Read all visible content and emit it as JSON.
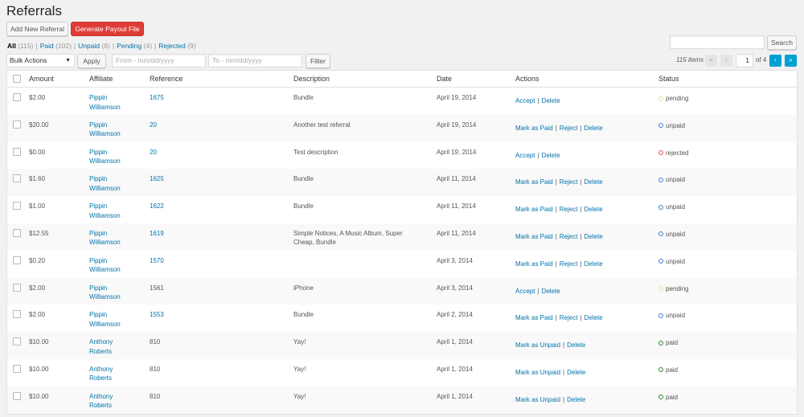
{
  "page_title": "Referrals",
  "header_buttons": {
    "add_new": "Add New Referral",
    "generate_payout": "Generate Payout File"
  },
  "views": [
    {
      "label": "All",
      "count": "(115)",
      "current": true
    },
    {
      "label": "Paid",
      "count": "(102)"
    },
    {
      "label": "Unpaid",
      "count": "(8)"
    },
    {
      "label": "Pending",
      "count": "(4)"
    },
    {
      "label": "Rejected",
      "count": "(9)"
    }
  ],
  "search": {
    "placeholder": "",
    "button": "Search"
  },
  "bulk": {
    "selected": "Bulk Actions",
    "apply": "Apply"
  },
  "date_filter": {
    "from_placeholder": "From - mm/dd/yyyy",
    "to_placeholder": "To - mm/dd/yyyy",
    "filter": "Filter"
  },
  "pagination": {
    "items": "115 items",
    "first": "«",
    "prev": "‹",
    "current_page": "1",
    "of_label": "of 4",
    "next": "›",
    "last": "»"
  },
  "columns": {
    "amount": "Amount",
    "affiliate": "Affiliate",
    "reference": "Reference",
    "description": "Description",
    "date": "Date",
    "actions": "Actions",
    "status": "Status"
  },
  "status_colors": {
    "pending": "#e6e6a0",
    "unpaid": "#3b7ed0",
    "rejected": "#e2584b",
    "paid": "#2a8a2a"
  },
  "rows": [
    {
      "amount": "$2.00",
      "affiliate": [
        "Pippin",
        "Williamson"
      ],
      "reference": "1675",
      "reference_link": true,
      "description": [
        "Bundle"
      ],
      "date": "April 19, 2014",
      "actions": [
        "Accept",
        "Delete"
      ],
      "status": "pending"
    },
    {
      "amount": "$20.00",
      "affiliate": [
        "Pippin",
        "Williamson"
      ],
      "reference": "20",
      "reference_link": true,
      "description": [
        "Another test referral"
      ],
      "date": "April 19, 2014",
      "actions": [
        "Mark as Paid",
        "Reject",
        "Delete"
      ],
      "status": "unpaid"
    },
    {
      "amount": "$0.00",
      "affiliate": [
        "Pippin",
        "Williamson"
      ],
      "reference": "20",
      "reference_link": true,
      "description": [
        "Test description"
      ],
      "date": "April 19, 2014",
      "actions": [
        "Accept",
        "Delete"
      ],
      "status": "rejected"
    },
    {
      "amount": "$1.60",
      "affiliate": [
        "Pippin",
        "Williamson"
      ],
      "reference": "1625",
      "reference_link": true,
      "description": [
        "Bundle"
      ],
      "date": "April 11, 2014",
      "actions": [
        "Mark as Paid",
        "Reject",
        "Delete"
      ],
      "status": "unpaid"
    },
    {
      "amount": "$1.00",
      "affiliate": [
        "Pippin",
        "Williamson"
      ],
      "reference": "1622",
      "reference_link": true,
      "description": [
        "Bundle"
      ],
      "date": "April 11, 2014",
      "actions": [
        "Mark as Paid",
        "Reject",
        "Delete"
      ],
      "status": "unpaid"
    },
    {
      "amount": "$12.55",
      "affiliate": [
        "Pippin",
        "Williamson"
      ],
      "reference": "1619",
      "reference_link": true,
      "description": [
        "Simple Notices, A Music Album, Super",
        "Cheap, Bundle"
      ],
      "date": "April 11, 2014",
      "actions": [
        "Mark as Paid",
        "Reject",
        "Delete"
      ],
      "status": "unpaid"
    },
    {
      "amount": "$0.20",
      "affiliate": [
        "Pippin",
        "Williamson"
      ],
      "reference": "1570",
      "reference_link": true,
      "description": [],
      "date": "April 3, 2014",
      "actions": [
        "Mark as Paid",
        "Reject",
        "Delete"
      ],
      "status": "unpaid"
    },
    {
      "amount": "$2.00",
      "affiliate": [
        "Pippin",
        "Williamson"
      ],
      "reference": "1561",
      "reference_link": false,
      "description": [
        "iPhone"
      ],
      "date": "April 3, 2014",
      "actions": [
        "Accept",
        "Delete"
      ],
      "status": "pending"
    },
    {
      "amount": "$2.00",
      "affiliate": [
        "Pippin",
        "Williamson"
      ],
      "reference": "1553",
      "reference_link": true,
      "description": [
        "Bundle"
      ],
      "date": "April 2, 2014",
      "actions": [
        "Mark as Paid",
        "Reject",
        "Delete"
      ],
      "status": "unpaid"
    },
    {
      "amount": "$10.00",
      "affiliate": [
        "Anthony",
        "Roberts"
      ],
      "reference": "810",
      "reference_link": false,
      "description": [
        "Yay!"
      ],
      "date": "April 1, 2014",
      "actions": [
        "Mark as Unpaid",
        "Delete"
      ],
      "status": "paid"
    },
    {
      "amount": "$10.00",
      "affiliate": [
        "Anthony",
        "Roberts"
      ],
      "reference": "810",
      "reference_link": false,
      "description": [
        "Yay!"
      ],
      "date": "April 1, 2014",
      "actions": [
        "Mark as Unpaid",
        "Delete"
      ],
      "status": "paid"
    },
    {
      "amount": "$10.00",
      "affiliate": [
        "Anthony",
        "Roberts"
      ],
      "reference": "810",
      "reference_link": false,
      "description": [
        "Yay!"
      ],
      "date": "April 1, 2014",
      "actions": [
        "Mark as Unpaid",
        "Delete"
      ],
      "status": "paid"
    }
  ]
}
